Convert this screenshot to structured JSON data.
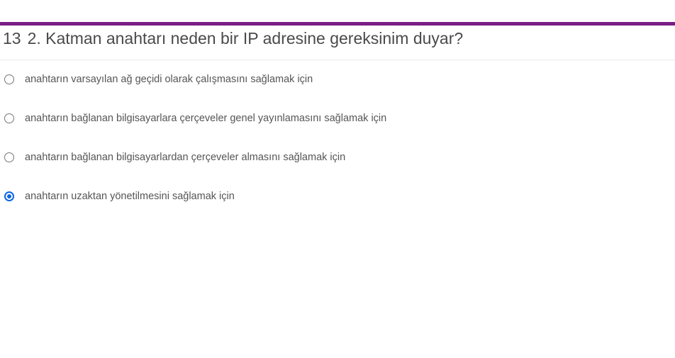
{
  "colors": {
    "accent_bar": "#7a1f86",
    "radio_selected": "#0a66e4"
  },
  "question": {
    "number": "13",
    "text": "2. Katman anahtarı neden bir IP adresine gereksinim duyar?"
  },
  "options": [
    {
      "label": "anahtarın varsayılan ağ geçidi olarak çalışmasını sağlamak için",
      "selected": false
    },
    {
      "label": "anahtarın bağlanan bilgisayarlara çerçeveler genel yayınlamasını sağlamak için",
      "selected": false
    },
    {
      "label": "anahtarın bağlanan bilgisayarlardan çerçeveler almasını sağlamak için",
      "selected": false
    },
    {
      "label": "anahtarın uzaktan yönetilmesini sağlamak için",
      "selected": true
    }
  ]
}
